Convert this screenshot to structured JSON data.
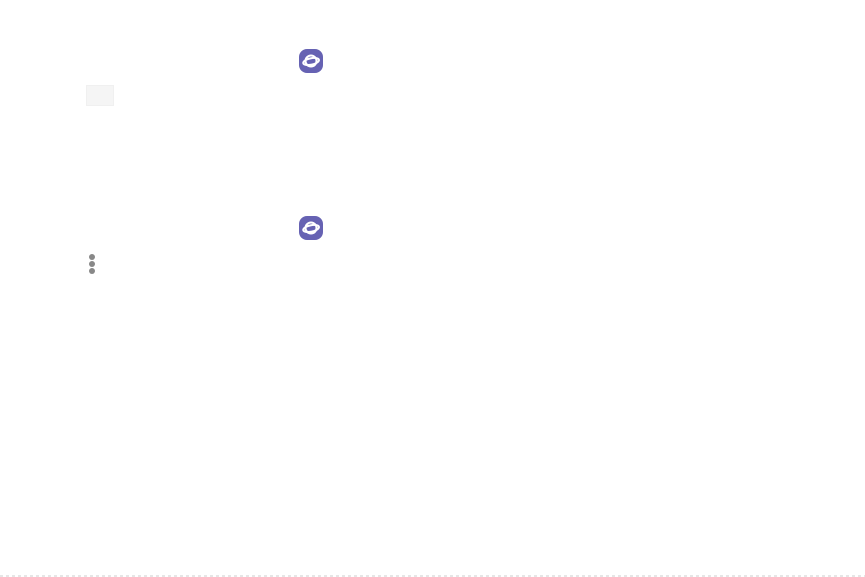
{
  "icons": {
    "browser_icon_top": "samsung-internet-icon",
    "tabs_icon": "tabs-icon",
    "browser_icon_bottom": "samsung-internet-icon",
    "more_options_icon": "more-vertical-icon"
  },
  "colors": {
    "background": "#ffffff",
    "brand_purple": "#6662b3",
    "planet_ring": "#ffffff",
    "more_dots": "#888888",
    "tab_fill": "#f5f5f5"
  }
}
